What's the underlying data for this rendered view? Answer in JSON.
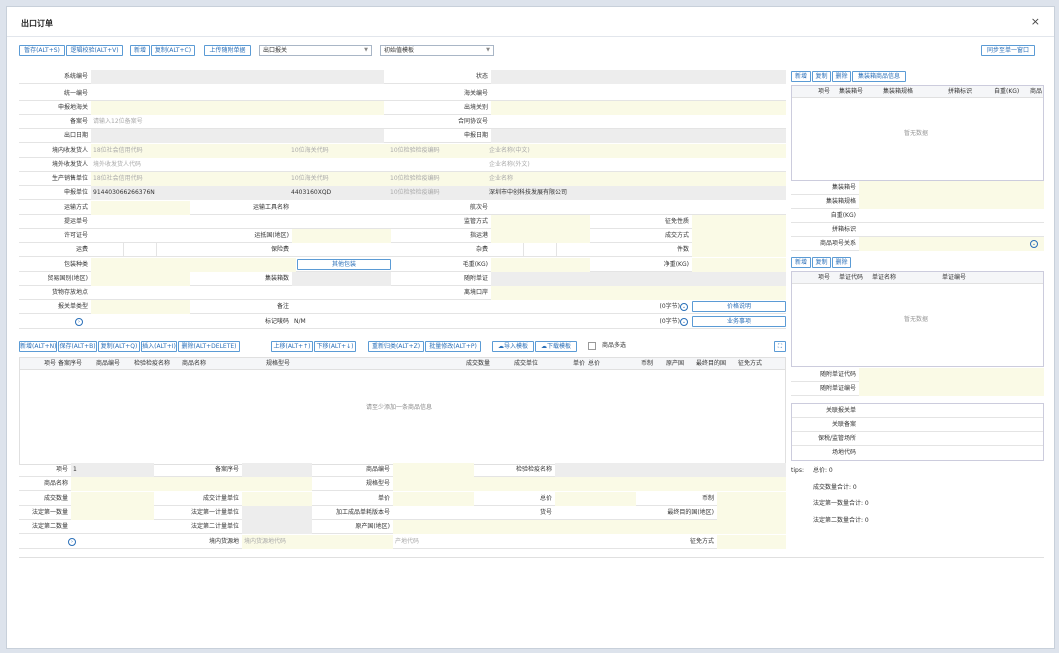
{
  "window": {
    "title": "出口订单",
    "close": "×"
  },
  "toolbar": {
    "save": "暂存(ALT+S)",
    "check": "逻辑校验(ALT+V)",
    "new": "新增",
    "copy": "复制(ALT+C)",
    "upload": "上传随附单据",
    "decl_type": "出口报关",
    "template": "初始值模板",
    "sync": "同步至单一窗口"
  },
  "form": {
    "r1": {
      "l1": "系统编号",
      "l2": "状态"
    },
    "r2": {
      "l1": "统一编号",
      "l2": "海关编号"
    },
    "r3": {
      "l1": "申报地海关",
      "l2": "出境关别"
    },
    "r4": {
      "l1": "备案号",
      "p1": "请输入12位备案号",
      "l2": "合同协议号"
    },
    "r5": {
      "l1": "出口日期",
      "l2": "申报日期"
    },
    "r6": {
      "l1": "境内收发货人",
      "p1": "18位社会信用代码",
      "p2": "10位海关代码",
      "p3": "10位检验检疫编码",
      "p4": "企业名称(中文)"
    },
    "r7": {
      "l1": "境外收发货人",
      "p1": "境外收发货人代码",
      "p4": "企业名称(外文)"
    },
    "r8": {
      "l1": "生产销售单位",
      "p1": "18位社会信用代码",
      "p2": "10位海关代码",
      "p3": "10位检验检疫编码",
      "p4": "企业名称"
    },
    "r9": {
      "l1": "申报单位",
      "v1": "914403066266376N",
      "v2": "4403160XQD",
      "p3": "10位检验检疫编码",
      "v4": "深圳市中创科技发展有限公司"
    },
    "r10": {
      "l1": "运输方式",
      "l2": "运输工具名称",
      "l3": "航次号"
    },
    "r11": {
      "l1": "提运单号",
      "l2": "监管方式",
      "l3": "征免性质"
    },
    "r12": {
      "l1": "许可证号",
      "l2": "运抵国(地区)",
      "l3": "指运港",
      "l4": "成交方式"
    },
    "r13": {
      "l1": "运费",
      "l2": "保险费",
      "l3": "杂费",
      "l4": "件数"
    },
    "r14": {
      "l1": "包装种类",
      "btn": "其他包装",
      "l3": "毛重(KG)",
      "l4": "净重(KG)"
    },
    "r15": {
      "l1": "贸易国别(地区)",
      "l2": "集装箱数",
      "l3": "随附单证"
    },
    "r16": {
      "l1": "货物存放地点",
      "l3": "离境口岸"
    },
    "r17": {
      "l1": "报关单类型",
      "l2": "备注",
      "bytes": "(0字节)",
      "btn": "价格说明"
    },
    "r18": {
      "l2": "标记唛码",
      "v2": "N/M",
      "bytes": "(0字节)",
      "btn": "业务事项"
    }
  },
  "goods_toolbar": {
    "new": "新增(ALT+N)",
    "save": "保存(ALT+B)",
    "copy": "复制(ALT+Q)",
    "insert": "插入(ALT+I)",
    "delete": "删除(ALT+DELETE)",
    "up": "上移(ALT+↑)",
    "down": "下移(ALT+↓)",
    "renumber": "重新归类(ALT+Z)",
    "batch": "批量修改(ALT+P)",
    "import": "导入模板",
    "download": "下载模板",
    "multi": "商品多选"
  },
  "goods_table": {
    "headers": [
      "项号",
      "备案序号",
      "商品编号",
      "检验检疫名称",
      "商品名称",
      "规格型号",
      "成交数量",
      "成交单位",
      "单价",
      "总价",
      "币制",
      "原产国",
      "最终目的国",
      "征免方式"
    ],
    "empty": "请至少添加一条商品信息"
  },
  "goods_form": {
    "g1": {
      "l1": "项号",
      "v1": "1",
      "l2": "备案序号",
      "l3": "商品编号",
      "l4": "检验检疫名称"
    },
    "g2": {
      "l1": "商品名称",
      "l3": "规格型号"
    },
    "g3": {
      "l1": "成交数量",
      "l2": "成交计量单位",
      "l3": "单价",
      "l4": "总价",
      "l5": "币制"
    },
    "g4": {
      "l1": "法定第一数量",
      "l2": "法定第一计量单位",
      "l3": "加工成品单耗版本号",
      "l4": "货号",
      "l5": "最终目的国(地区)"
    },
    "g5": {
      "l1": "法定第二数量",
      "l2": "法定第二计量单位",
      "l3": "原产国(地区)"
    },
    "g6": {
      "l2": "境内货源地",
      "p2": "境内货源地代码",
      "p3": "产地代码",
      "l5": "征免方式"
    }
  },
  "container": {
    "new": "新增",
    "copy": "复制",
    "delete": "删除",
    "goods_info": "集装箱商品信息",
    "headers": [
      "项号",
      "集装箱号",
      "集装箱规格",
      "拼箱标识",
      "自重(KG)",
      "商品"
    ],
    "empty": "暂无数据",
    "f1": "集装箱号",
    "f2": "集装箱规格",
    "f3": "自重(KG)",
    "f4": "拼箱标识",
    "f5": "商品项号关系"
  },
  "docs": {
    "new": "新增",
    "copy": "复制",
    "delete": "删除",
    "headers": [
      "项号",
      "单证代码",
      "单证名称",
      "单证编号"
    ],
    "empty": "暂无数据",
    "f1": "随附单证代码",
    "f2": "随附单证编号"
  },
  "related": {
    "f1": "关联报关单",
    "f2": "关联备案",
    "f3": "保税/监管场所",
    "f4": "场地代码"
  },
  "summary": {
    "tips": "tips:",
    "total": "总价: 0",
    "deal_qty": "成交数量合计: 0",
    "legal1": "法定第一数量合计: 0",
    "legal2": "法定第二数量合计: 0"
  }
}
